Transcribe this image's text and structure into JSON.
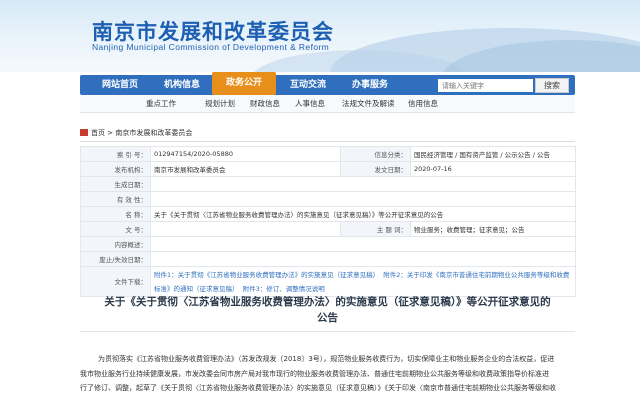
{
  "header": {
    "title": "南京市发展和改革委员会",
    "subtitle": "Nanjing Municipal Commission of Development & Reform"
  },
  "nav": {
    "items": [
      {
        "label": "网站首页"
      },
      {
        "label": "机构信息"
      },
      {
        "label": "政务公开",
        "active": true
      },
      {
        "label": "互动交流"
      },
      {
        "label": "办事服务"
      }
    ],
    "search_placeholder": "请输入关键字",
    "search_button": "搜索"
  },
  "subnav": {
    "items": [
      "重点工作",
      "规划计划",
      "财政信息",
      "人事信息",
      "法规文件及解读",
      "信用信息"
    ]
  },
  "breadcrumb": {
    "home": "首页",
    "separator": ">",
    "current": "南京市发展和改革委员会"
  },
  "info": {
    "index_label": "索 引 号：",
    "index_value": "012947154/2020-05880",
    "category_label": "信息分类：",
    "category_value": "国民经济管理 / 国有资产监管 / 公示公告 / 公告",
    "publisher_label": "发布机构：",
    "publisher_value": "南京市发展和改革委员会",
    "pubdate_label": "发文日期：",
    "pubdate_value": "2020-07-16",
    "created_label": "生成日期：",
    "created_value": "",
    "validity_label": "有 效 性：",
    "validity_value": "",
    "name_label": "名   称：",
    "name_value": "关于《关于贯彻〈江苏省物业服务收费管理办法〉的实施意见（征求意见稿）》等公开征求意见的公告",
    "docno_label": "文   号：",
    "docno_value": "",
    "keywords_label": "主 题 词：",
    "keywords_value": "物业服务；收费管理；征求意见；公告",
    "content_label": "内容概述：",
    "content_value": "",
    "expiry_label": "废止/失效日期：",
    "expiry_value": "",
    "attach_label": "文件下载：",
    "attach_1": "附件1：关于贯彻《江苏省物业服务收费管理办法》的实施意见（征求意见稿）",
    "attach_2": "附件2：关于印发《南京市普通住宅前期物业公共服务等级和收费标准》的通知（征求意见稿）",
    "attach_3": "附件3：修订、调整情况说明"
  },
  "article": {
    "title_line1": "关于《关于贯彻〈江苏省物业服务收费管理办法〉的实施意见（征求意见稿）》等公开征求意见的",
    "title_line2": "公告",
    "body_line1": "为贯彻落实《江苏省物业服务收费管理办法》（苏发改规发〔2018〕3号），规范物业服务收费行为，切实保障业主和物业服务企业的合法权益，促进",
    "body_line2": "我市物业服务行业持续健康发展，市发改委会同市房产局对我市现行的物业服务收费管理办法、普通住宅前期物业公共服务等级和收费政策指导价标准进",
    "body_line3_a": "行了修订、调整，起草了《关于贯彻〈江苏省物业服务收费管理办法〉的实施意见（征求意见稿）》《关于印发〈南京市普通住宅前期物业公共服务等级和收"
  },
  "colors": {
    "brand_blue": "#2f6fbe",
    "active_orange": "#e88e1b",
    "label_bg": "#f2f6fb"
  }
}
